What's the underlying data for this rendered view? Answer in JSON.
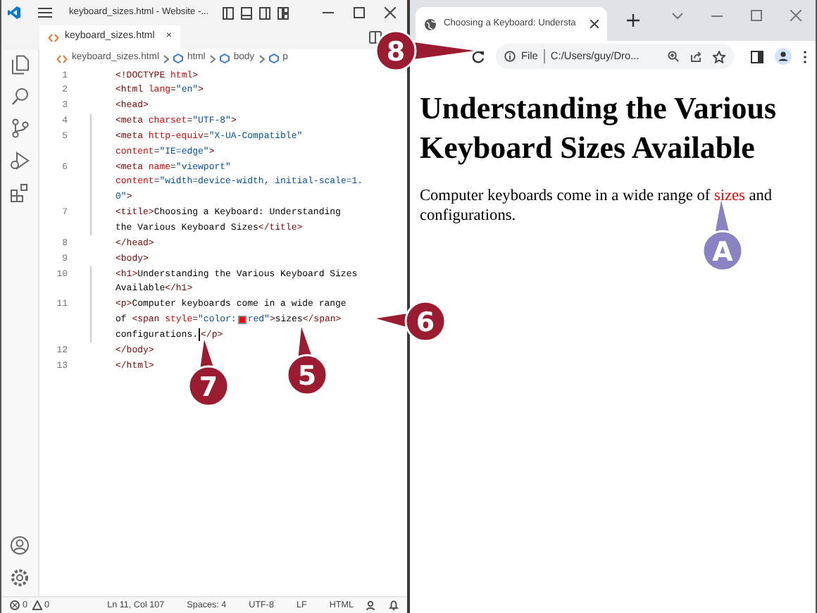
{
  "editor": {
    "title": "keyboard_sizes.html - Website -...",
    "tab": {
      "label": "keyboard_sizes.html",
      "close": "×"
    },
    "breadcrumb": [
      "keyboard_sizes.html",
      "html",
      "body",
      "p"
    ],
    "lines": [
      {
        "number": "1",
        "indented": false,
        "tokens": [
          {
            "kind": "tag",
            "text": "<!DOCTYPE "
          },
          {
            "kind": "attr",
            "text": "html"
          },
          {
            "kind": "tag",
            "text": ">"
          }
        ]
      },
      {
        "number": "2",
        "indented": false,
        "tokens": [
          {
            "kind": "tag",
            "text": "<html "
          },
          {
            "kind": "attr",
            "text": "lang"
          },
          {
            "kind": "text",
            "text": "="
          },
          {
            "kind": "value",
            "text": "\"en\""
          },
          {
            "kind": "tag",
            "text": ">"
          }
        ]
      },
      {
        "number": "3",
        "indented": false,
        "tokens": [
          {
            "kind": "tag",
            "text": "<head>"
          }
        ]
      },
      {
        "number": "4",
        "indented": true,
        "tokens": [
          {
            "kind": "tag",
            "text": "<meta "
          },
          {
            "kind": "attr",
            "text": "charset"
          },
          {
            "kind": "text",
            "text": "="
          },
          {
            "kind": "value",
            "text": "\"UTF-8\""
          },
          {
            "kind": "tag",
            "text": ">"
          }
        ]
      },
      {
        "number": "5",
        "indented": true,
        "tokens": [
          {
            "kind": "tag",
            "text": "<meta "
          },
          {
            "kind": "attr",
            "text": "http-equiv"
          },
          {
            "kind": "text",
            "text": "="
          },
          {
            "kind": "value",
            "text": "\"X-UA-Compatible\""
          }
        ]
      },
      {
        "indented": true,
        "tokens": [
          {
            "kind": "attr",
            "text": "content"
          },
          {
            "kind": "text",
            "text": "="
          },
          {
            "kind": "value",
            "text": "\"IE=edge\""
          },
          {
            "kind": "tag",
            "text": ">"
          }
        ]
      },
      {
        "number": "6",
        "indented": true,
        "tokens": [
          {
            "kind": "tag",
            "text": "<meta "
          },
          {
            "kind": "attr",
            "text": "name"
          },
          {
            "kind": "text",
            "text": "="
          },
          {
            "kind": "value",
            "text": "\"viewport\""
          }
        ]
      },
      {
        "indented": true,
        "tokens": [
          {
            "kind": "attr",
            "text": "content"
          },
          {
            "kind": "text",
            "text": "="
          },
          {
            "kind": "value",
            "text": "\"width=device-width, initial-scale=1."
          }
        ]
      },
      {
        "indented": true,
        "tokens": [
          {
            "kind": "value",
            "text": "0\""
          },
          {
            "kind": "tag",
            "text": ">"
          }
        ]
      },
      {
        "number": "7",
        "indented": true,
        "tokens": [
          {
            "kind": "tag",
            "text": "<title>"
          },
          {
            "kind": "text",
            "text": "Choosing a Keyboard: Understanding"
          }
        ]
      },
      {
        "indented": true,
        "tokens": [
          {
            "kind": "text",
            "text": "the Various Keyboard Sizes"
          },
          {
            "kind": "tag",
            "text": "</title>"
          }
        ]
      },
      {
        "number": "8",
        "indented": false,
        "tokens": [
          {
            "kind": "tag",
            "text": "</head>"
          }
        ]
      },
      {
        "number": "9",
        "indented": false,
        "tokens": [
          {
            "kind": "tag",
            "text": "<body>"
          }
        ]
      },
      {
        "number": "10",
        "indented": true,
        "tokens": [
          {
            "kind": "tag",
            "text": "<h1>"
          },
          {
            "kind": "text",
            "text": "Understanding the Various Keyboard Sizes"
          }
        ]
      },
      {
        "indented": true,
        "tokens": [
          {
            "kind": "text",
            "text": "Available"
          },
          {
            "kind": "tag",
            "text": "</h1>"
          }
        ]
      },
      {
        "number": "11",
        "indented": true,
        "tokens": [
          {
            "kind": "tag",
            "text": "<p>"
          },
          {
            "kind": "text",
            "text": "Computer keyboards come in a wide range"
          }
        ]
      },
      {
        "indented": true,
        "tokens": [
          {
            "kind": "text",
            "text": "of "
          },
          {
            "kind": "tag",
            "text": "<span "
          },
          {
            "kind": "attr",
            "text": "style"
          },
          {
            "kind": "text",
            "text": "="
          },
          {
            "kind": "value",
            "text": "\"color:"
          },
          {
            "kind": "swatch",
            "color": "#ff0000"
          },
          {
            "kind": "value",
            "text": "red\""
          },
          {
            "kind": "tag",
            "text": ">"
          },
          {
            "kind": "text",
            "text": "sizes"
          },
          {
            "kind": "tag",
            "text": "</span>"
          }
        ]
      },
      {
        "indented": true,
        "tokens": [
          {
            "kind": "text",
            "text": "configurations."
          },
          {
            "kind": "cursor"
          },
          {
            "kind": "tag",
            "text": "</p>"
          }
        ]
      },
      {
        "number": "12",
        "indented": false,
        "tokens": [
          {
            "kind": "tag",
            "text": "</body>"
          }
        ]
      },
      {
        "number": "13",
        "indented": false,
        "tokens": [
          {
            "kind": "tag",
            "text": "</html>"
          }
        ]
      }
    ],
    "status_left": {
      "errors": "0",
      "warnings": "0"
    },
    "status_right": [
      "Ln 11, Col 107",
      "Spaces: 4",
      "UTF-8",
      "LF",
      "HTML"
    ]
  },
  "browser": {
    "tab_title": "Choosing a Keyboard: Understa",
    "address": {
      "scheme": "File",
      "url": "C:/Users/guy/Dro..."
    },
    "heading": "Understanding the Various Keyboard Sizes Available",
    "paragraph": [
      {
        "text": "Computer keyboards come in a wide range of "
      },
      {
        "text": "sizes",
        "color": "#ff0000"
      },
      {
        "text": " and configurations."
      }
    ]
  },
  "callouts": [
    {
      "label": "8",
      "kind": "step"
    },
    {
      "label": "6",
      "kind": "step"
    },
    {
      "label": "5",
      "kind": "step"
    },
    {
      "label": "7",
      "kind": "step"
    },
    {
      "label": "A",
      "kind": "result"
    }
  ]
}
